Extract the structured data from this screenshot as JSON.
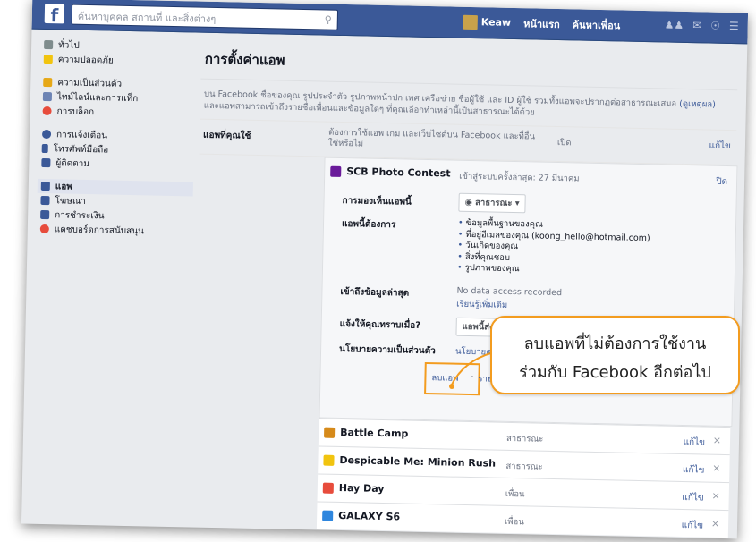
{
  "topbar": {
    "logo": "f",
    "search_placeholder": "ค้นหาบุคคล สถานที่ และสิ่งต่างๆ",
    "user_name": "Keaw",
    "home_label": "หน้าแรก",
    "friends_label": "ค้นหาเพื่อน"
  },
  "sidebar": {
    "group1": [
      {
        "label": "ทั่วไป",
        "icon": "gear-icon",
        "color": "#7f8c8d"
      },
      {
        "label": "ความปลอดภัย",
        "icon": "shield-icon",
        "color": "#f1c40f"
      }
    ],
    "group2": [
      {
        "label": "ความเป็นส่วนตัว",
        "icon": "lock-icon",
        "color": "#e6a817"
      },
      {
        "label": "ไทม์ไลน์และการแท็ก",
        "icon": "timeline-icon",
        "color": "#6d84b4"
      },
      {
        "label": "การบล็อก",
        "icon": "block-icon",
        "color": "#e74c3c"
      }
    ],
    "group3": [
      {
        "label": "การแจ้งเตือน",
        "icon": "globe-icon",
        "color": "#3b5998"
      },
      {
        "label": "โทรศัพท์มือถือ",
        "icon": "mobile-icon",
        "color": "#3b5998"
      },
      {
        "label": "ผู้ติดตาม",
        "icon": "rss-icon",
        "color": "#3b5998"
      }
    ],
    "group4": [
      {
        "label": "แอพ",
        "icon": "apps-icon",
        "color": "#3b5998",
        "active": true
      },
      {
        "label": "โฆษณา",
        "icon": "ads-icon",
        "color": "#3b5998"
      },
      {
        "label": "การชำระเงิน",
        "icon": "payment-icon",
        "color": "#3b5998"
      },
      {
        "label": "แดชบอร์ดการสนับสนุน",
        "icon": "support-icon",
        "color": "#e74c3c"
      }
    ]
  },
  "main": {
    "title": "การตั้งค่าแอพ",
    "intro_text": "บน Facebook ชื่อของคุณ รูปประจำตัว รูปภาพหน้าปก เพศ เครือข่าย ชื่อผู้ใช้ และ ID ผู้ใช้ รวมทั้งแอพจะปรากฏต่อสาธารณะเสมอ",
    "intro_link": "(ดูเหตุผล)",
    "intro_text2": " และแอพสามารถเข้าถึงรายชื่อเพื่อนและข้อมูลใดๆ ที่คุณเลือกทำเหล่านี้เป็นสาธารณะได้ด้วย",
    "used_apps_label": "แอพที่คุณใช้",
    "used_apps_desc": "ต้องการใช้แอพ เกม และเว็บไซต์บน Facebook และที่อื่นใช่หรือไม่",
    "used_apps_value": "เปิด",
    "edit": "แก้ไข",
    "expanded_app": {
      "name": "SCB Photo Contest",
      "last_login": "เข้าสู่ระบบครั้งล่าสุด: 27 มีนาคม",
      "close": "ปิด",
      "visibility_label": "การมองเห็นแอพนี้",
      "visibility_value": "สาธารณะ",
      "needs_label": "แอพนี้ต้องการ",
      "needs": [
        "ข้อมูลพื้นฐานของคุณ",
        "ที่อยู่อีเมลของคุณ (koong_hello@hotmail.com)",
        "วันเกิดของคุณ",
        "สิ่งที่คุณชอบ",
        "รูปภาพของคุณ"
      ],
      "recent_access_label": "เข้าถึงข้อมูลล่าสุด",
      "recent_access_value": "No data access recorded",
      "recent_access_link": "เรียนรู้เพิ่มเติม",
      "notify_label": "แจ้งให้คุณทราบเมื่อ?",
      "notify_value": "แอพนี้ส่งการแจ้งเตือน",
      "privacy_label": "นโยบายความเป็นส่วนตัว",
      "privacy_link": "นโยบายความเป็นส่วนตัว",
      "remove_link": "ลบแอพ",
      "report_link": "รายงานแอพ"
    },
    "apps": [
      {
        "name": "Battle Camp",
        "audience": "สาธารณะ",
        "icon_color": "#d68a1a"
      },
      {
        "name": "Despicable Me: Minion Rush",
        "audience": "สาธารณะ",
        "icon_color": "#f1c40f"
      },
      {
        "name": "Hay Day",
        "audience": "เพื่อน",
        "icon_color": "#e74c3c"
      },
      {
        "name": "GALAXY S6",
        "audience": "เพื่อน",
        "icon_color": "#2e86de"
      }
    ]
  },
  "callout": {
    "line1": "ลบแอพที่ไม่ต้องการใช้งาน",
    "line2": "ร่วมกับ Facebook อีกต่อไป"
  },
  "colors": {
    "brand": "#3b5998",
    "highlight": "#f39c1f"
  }
}
